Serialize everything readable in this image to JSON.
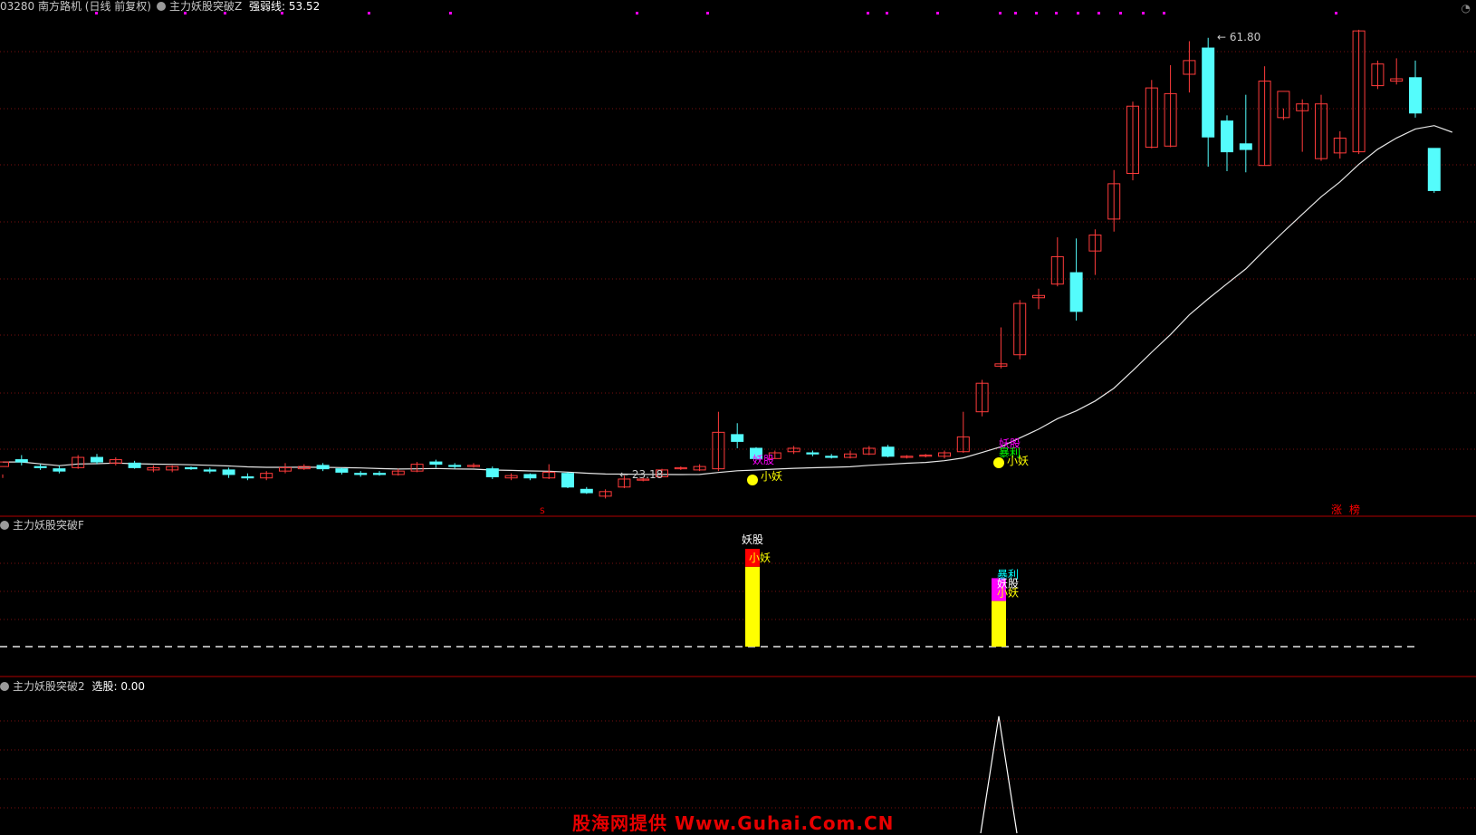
{
  "header": {
    "stock": "03280 南方路机 (日线 前复权)",
    "indicator_main": "主力妖股突破Z",
    "line_label": "强弱线:",
    "line_value": "53.52"
  },
  "panel2": {
    "title": "主力妖股突破F"
  },
  "panel3": {
    "title": "主力妖股突破2",
    "value_label": "选股:",
    "value": "0.00"
  },
  "watermark": "股海网提供 Www.Guhai.Com.CN",
  "colors": {
    "up": "#ff3b3b",
    "down": "#54fcfc",
    "ma": "#e6e6e6",
    "grid": "#8b0000",
    "divider": "#b00000",
    "yellow": "#ffff00",
    "magenta": "#ff00ff",
    "red_label": "#ff0000"
  },
  "chart_data": [
    {
      "type": "candlestick",
      "title": "主力妖股突破Z",
      "series": [
        {
          "name": "K线",
          "candles": [
            [
              24.2,
              24.6,
              23.2,
              23.5
            ],
            [
              24.8,
              24.6,
              25.2,
              24.3
            ],
            [
              24.2,
              24.1,
              24.4,
              23.9
            ],
            [
              24.0,
              23.8,
              24.3,
              23.6
            ],
            [
              24.1,
              25.0,
              25.2,
              24.0
            ],
            [
              25.0,
              24.6,
              25.3,
              24.4
            ],
            [
              24.5,
              24.8,
              25.0,
              24.3
            ],
            [
              24.5,
              24.1,
              24.7,
              24.0
            ],
            [
              23.9,
              24.1,
              24.3,
              23.7
            ],
            [
              23.9,
              24.2,
              24.3,
              23.7
            ],
            [
              24.1,
              24.0,
              24.2,
              23.9
            ],
            [
              23.9,
              23.8,
              24.1,
              23.6
            ],
            [
              23.9,
              23.5,
              24.1,
              23.2
            ],
            [
              23.3,
              23.2,
              23.6,
              23.0
            ],
            [
              23.2,
              23.6,
              23.8,
              23.0
            ],
            [
              23.8,
              24.1,
              24.5,
              23.6
            ],
            [
              24.0,
              24.2,
              24.4,
              23.9
            ],
            [
              24.3,
              24.0,
              24.5,
              23.8
            ],
            [
              24.0,
              23.7,
              24.1,
              23.5
            ],
            [
              23.6,
              23.5,
              23.8,
              23.3
            ],
            [
              23.6,
              23.5,
              23.8,
              23.4
            ],
            [
              23.5,
              23.8,
              24.0,
              23.4
            ],
            [
              23.8,
              24.4,
              24.6,
              23.7
            ],
            [
              24.6,
              24.4,
              24.8,
              24.1
            ],
            [
              24.3,
              24.2,
              24.5,
              24.0
            ],
            [
              24.2,
              24.3,
              24.5,
              24.1
            ],
            [
              24.0,
              23.3,
              24.2,
              23.1
            ],
            [
              23.2,
              23.4,
              23.6,
              23.0
            ],
            [
              23.5,
              23.2,
              23.6,
              23.0
            ],
            [
              23.2,
              23.7,
              24.4,
              23.1
            ],
            [
              23.6,
              22.4,
              23.7,
              22.3
            ],
            [
              22.2,
              21.9,
              22.4,
              21.8
            ],
            [
              21.6,
              22.0,
              22.2,
              21.4
            ],
            [
              22.4,
              23.1,
              23.4,
              22.3
            ],
            [
              23.0,
              23.1,
              23.2,
              22.9
            ],
            [
              23.3,
              23.9,
              24.0,
              23.3
            ],
            [
              24.0,
              24.1,
              24.2,
              23.9
            ],
            [
              23.9,
              24.2,
              24.4,
              23.8
            ],
            [
              24.0,
              27.2,
              29.0,
              23.8
            ],
            [
              27.0,
              26.4,
              28.0,
              25.8
            ],
            [
              25.8,
              24.9,
              25.9,
              24.7
            ],
            [
              24.9,
              25.4,
              25.6,
              24.9
            ],
            [
              25.5,
              25.8,
              26.0,
              25.3
            ],
            [
              25.4,
              25.3,
              25.6,
              25.1
            ],
            [
              25.1,
              25.0,
              25.3,
              24.9
            ],
            [
              25.0,
              25.3,
              25.6,
              24.9
            ],
            [
              25.3,
              25.8,
              26.0,
              25.2
            ],
            [
              25.9,
              25.1,
              26.1,
              25.0
            ],
            [
              25.0,
              25.1,
              25.2,
              24.9
            ],
            [
              25.1,
              25.2,
              25.3,
              25.0
            ],
            [
              25.1,
              25.4,
              25.6,
              24.9
            ],
            [
              25.5,
              26.8,
              29.0,
              25.4
            ],
            [
              29.0,
              31.5,
              31.8,
              28.6
            ],
            [
              33.0,
              33.2,
              36.4,
              32.8
            ],
            [
              34.0,
              38.5,
              38.8,
              33.6
            ],
            [
              39.0,
              39.2,
              39.8,
              38.0
            ],
            [
              40.2,
              42.6,
              44.3,
              40.0
            ],
            [
              41.2,
              37.8,
              44.2,
              37.0
            ],
            [
              43.1,
              44.5,
              45.0,
              41.0
            ],
            [
              45.9,
              49.0,
              50.2,
              44.8
            ],
            [
              49.9,
              55.8,
              56.2,
              49.3
            ],
            [
              52.2,
              57.4,
              58.1,
              52.1
            ],
            [
              52.3,
              56.9,
              59.4,
              52.2
            ],
            [
              58.6,
              59.8,
              61.5,
              57.0
            ],
            [
              60.9,
              53.1,
              61.8,
              50.5
            ],
            [
              54.5,
              51.8,
              55.0,
              50.1
            ],
            [
              52.5,
              52.0,
              56.8,
              50.0
            ],
            [
              50.6,
              58.0,
              59.3,
              50.6
            ],
            [
              54.8,
              57.1,
              55.6,
              54.6
            ],
            [
              55.4,
              56.0,
              56.4,
              51.8
            ],
            [
              51.2,
              56.0,
              56.8,
              51.0
            ],
            [
              51.7,
              53.0,
              53.6,
              51.2
            ],
            [
              51.8,
              62.4,
              62.5,
              51.6
            ],
            [
              57.6,
              59.5,
              59.8,
              57.3
            ],
            [
              58.0,
              58.2,
              60.0,
              57.7
            ],
            [
              58.3,
              55.2,
              59.8,
              54.8
            ],
            [
              52.1,
              48.4,
              52.1,
              48.2
            ]
          ]
        },
        {
          "name": "强弱线",
          "last_value": 53.52
        }
      ],
      "annotations": [
        {
          "text": "61.80",
          "kind": "high"
        },
        {
          "text": "23.18",
          "kind": "low"
        },
        {
          "text": "妖股",
          "kind": "signal"
        },
        {
          "text": "小妖",
          "kind": "signal"
        },
        {
          "text": "妖股",
          "kind": "signal"
        },
        {
          "text": "暴利",
          "kind": "signal"
        },
        {
          "text": "小妖",
          "kind": "signal"
        },
        {
          "text": "涨",
          "kind": "marker"
        },
        {
          "text": "榜",
          "kind": "marker"
        },
        {
          "text": "S",
          "kind": "marker"
        }
      ],
      "ylim": [
        20,
        64
      ],
      "grid": true
    },
    {
      "type": "bar",
      "title": "主力妖股突破F",
      "signals": [
        {
          "labels": [
            "妖股",
            "小妖"
          ],
          "segments": [
            {
              "color": "yellow",
              "value": 2.45
            },
            {
              "color": "red",
              "value": 0.55
            }
          ]
        },
        {
          "labels": [
            "暴利",
            "妖股",
            "小妖"
          ],
          "segments": [
            {
              "color": "yellow",
              "value": 1.4
            },
            {
              "color": "magenta",
              "value": 0.7
            }
          ]
        }
      ],
      "ylim": [
        0,
        3.5
      ],
      "grid": true
    },
    {
      "type": "line",
      "title": "主力妖股突破2",
      "series": [
        {
          "name": "选股",
          "spike": 1,
          "baseline": 0
        }
      ],
      "ylim": [
        0,
        1.2
      ],
      "grid": true
    }
  ]
}
